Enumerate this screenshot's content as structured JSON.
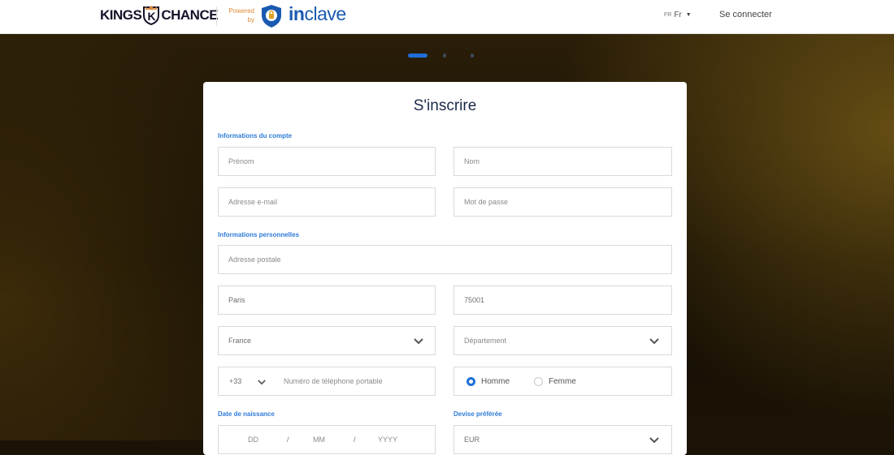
{
  "header": {
    "brand_left": "KINGS",
    "brand_mid": "K",
    "brand_right": "CHANCE",
    "powered_line1": "Powered",
    "powered_line2": "by",
    "inclave_prefix": "in",
    "inclave_suffix": "clave",
    "lang_small": "FR",
    "lang_label": "Fr",
    "login_label": "Se connecter"
  },
  "carousel": {
    "active_index": 0,
    "count": 3
  },
  "form": {
    "title": "S'inscrire",
    "section_account": "Informations du compte",
    "firstname": {
      "placeholder": "Prénom"
    },
    "lastname": {
      "placeholder": "Nom"
    },
    "email": {
      "placeholder": "Adresse e-mail"
    },
    "password": {
      "placeholder": "Mot de passe"
    },
    "section_personal": "Informations personnelles",
    "address": {
      "placeholder": "Adresse postale"
    },
    "city": {
      "value": "Paris"
    },
    "zip": {
      "value": "75001"
    },
    "country": {
      "value": "France"
    },
    "department": {
      "placeholder": "Département"
    },
    "phone": {
      "prefix": "+33",
      "placeholder": "Numéro de téléphone portable"
    },
    "gender": {
      "option_male": "Homme",
      "option_female": "Femme",
      "selected": "Homme"
    },
    "section_birthdate": "Date de naissance",
    "birth": {
      "day": "DD",
      "month": "MM",
      "year": "YYYY",
      "sep": "/"
    },
    "section_currency": "Devise préférée",
    "currency": {
      "value": "EUR"
    }
  },
  "colors": {
    "accent": "#1f6fd6",
    "section_label": "#2f7bd6",
    "brand_orange": "#e08a3a",
    "brand_blue": "#1a5ab0"
  }
}
